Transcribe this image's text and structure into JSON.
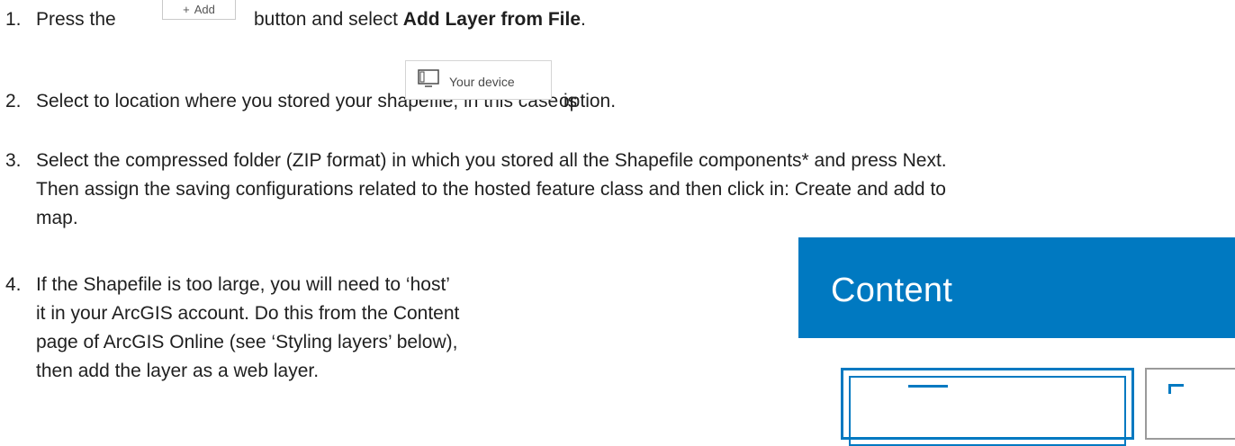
{
  "steps": [
    {
      "number": "1.",
      "before": "Press the",
      "button_label": "Add",
      "after": "button and select",
      "bold": "Add Layer from File",
      "end": "."
    },
    {
      "number": "2.",
      "before": "Select to location where you stored your shapefile, in this case is",
      "button_label": "Your device",
      "after": "option."
    },
    {
      "number": "3.",
      "line1": "Select the compressed folder (ZIP format) in which you stored all the Shapefile components* and press Next.",
      "line2": "Then assign the saving configurations related to the hosted feature class and then click in: Create and add to",
      "line3": "map."
    },
    {
      "number": "4.",
      "line1": "If the Shapefile is too large, you will need to ‘host’",
      "line2": "it in your ArcGIS account. Do this from the Content",
      "line3": "page of ArcGIS Online (see ‘Styling layers’ below),",
      "line4": "then add the layer as a web layer."
    }
  ],
  "content_panel": {
    "title": "Content",
    "header_color": "#0079c1"
  },
  "icons": {
    "add": "plus-icon",
    "device": "monitor-icon"
  }
}
